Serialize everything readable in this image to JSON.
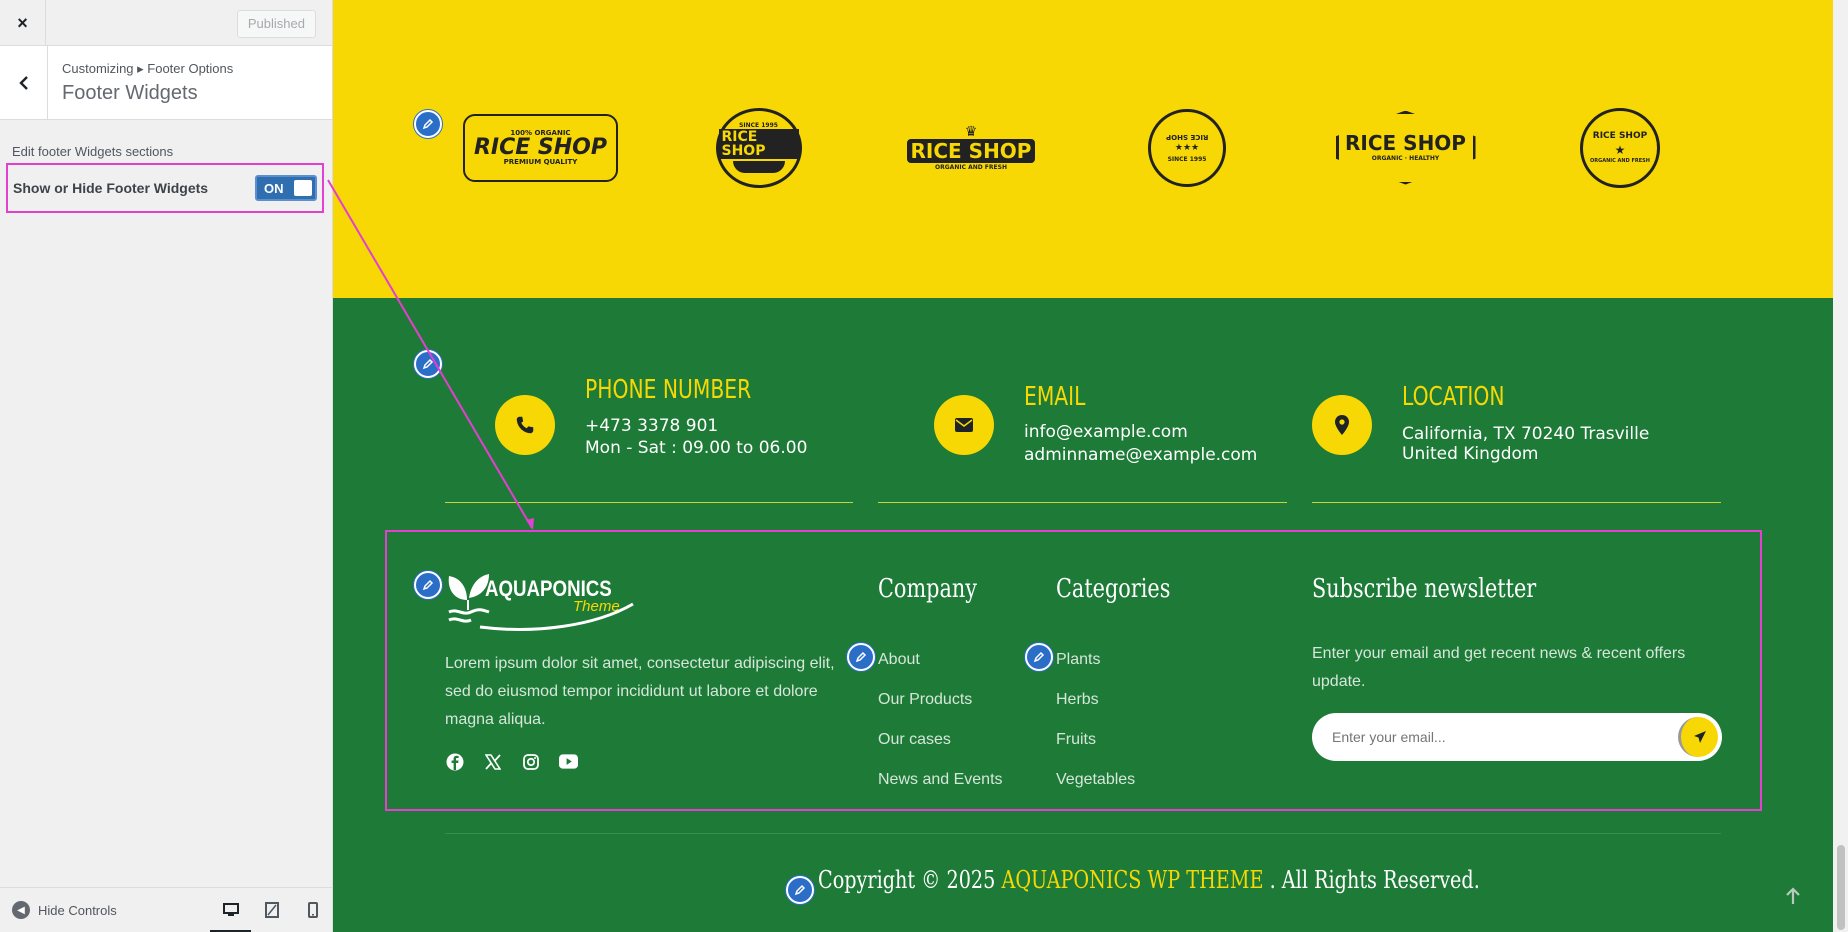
{
  "sidebar": {
    "close_label": "×",
    "published_label": "Published",
    "breadcrumb": "Customizing ▸ Footer Options",
    "section_title": "Footer Widgets",
    "description": "Edit footer Widgets sections",
    "toggle_label": "Show or Hide Footer Widgets",
    "toggle_state": "ON",
    "hide_controls": "Hide Controls"
  },
  "brand_logos": [
    {
      "top": "100% ORGANIC",
      "main": "RICE SHOP",
      "bottom": "PREMIUM QUALITY"
    },
    {
      "top": "SINCE 1995",
      "main": "RICE SHOP",
      "bottom": ""
    },
    {
      "top": "",
      "main": "RICE SHOP",
      "bottom": "ORGANIC AND FRESH"
    },
    {
      "top": "RICE SHOP",
      "main": "★★★",
      "bottom": "SINCE 1995"
    },
    {
      "top": "",
      "main": "RICE SHOP",
      "bottom": "ORGANIC · HEALTHY"
    },
    {
      "top": "RICE SHOP",
      "main": "★",
      "bottom": "ORGANIC AND FRESH"
    }
  ],
  "contact": {
    "phone": {
      "title": "PHONE NUMBER",
      "line1": "+473 3378 901",
      "line2": "Mon - Sat : 09.00 to 06.00"
    },
    "email": {
      "title": "EMAIL",
      "line1": "info@example.com",
      "line2": "adminname@example.com"
    },
    "location": {
      "title": "LOCATION",
      "line1": "California, TX 70240 Trasville",
      "line2": "United Kingdom"
    }
  },
  "footer": {
    "logo_main": "AQUAPONICS",
    "logo_sub": "Theme",
    "about": "Lorem ipsum dolor sit amet, consectetur adipiscing elit, sed do eiusmod tempor incididunt ut labore et dolore magna aliqua.",
    "company_heading": "Company",
    "company_links": [
      "About",
      "Our Products",
      "Our cases",
      "News and Events"
    ],
    "categories_heading": "Categories",
    "categories_links": [
      "Plants",
      "Herbs",
      "Fruits",
      "Vegetables"
    ],
    "newsletter_heading": "Subscribe newsletter",
    "newsletter_text": "Enter your email and get recent news & recent offers update.",
    "email_placeholder": "Enter your email...",
    "copyright_prefix": "Copyright © 2025 ",
    "copyright_link": "AQUAPONICS WP THEME",
    "copyright_suffix": " . All Rights Reserved."
  },
  "colors": {
    "yellow": "#f7d804",
    "green": "#1d7b37",
    "highlight": "#e33fd0",
    "edit_blue": "#2a6ec7"
  }
}
